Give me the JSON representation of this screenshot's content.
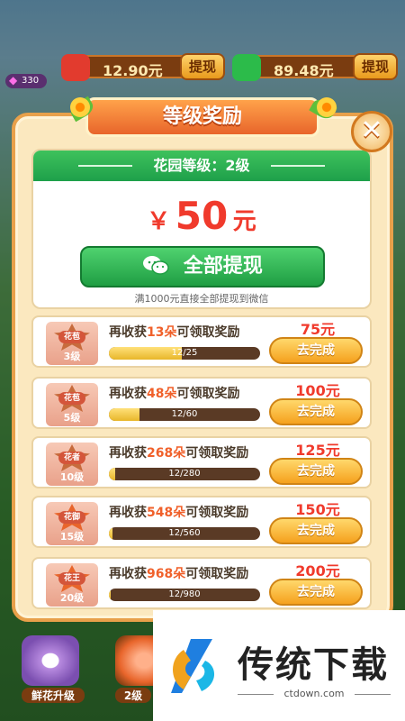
{
  "currency": {
    "red_packet": {
      "value": "12.90元",
      "button": "提现"
    },
    "wechat": {
      "value": "89.48元",
      "button": "提现"
    },
    "gem_count": "330"
  },
  "modal": {
    "title": "等级奖励",
    "close": "✕",
    "garden_level": "花园等级：2级",
    "amount_currency": "￥",
    "amount_value": "50",
    "amount_unit": "元",
    "withdraw_all": "全部提现",
    "hint": "满1000元直接全部提现到微信"
  },
  "tasks": [
    {
      "badge": "花苞",
      "level": "3级",
      "prefix": "再收获",
      "count": "13朵",
      "suffix": "可领取奖励",
      "progress_text": "12/25",
      "progress": 0.48,
      "reward": "75元",
      "button": "去完成",
      "badge_color": "#c76b3c"
    },
    {
      "badge": "花苞",
      "level": "5级",
      "prefix": "再收获",
      "count": "48朵",
      "suffix": "可领取奖励",
      "progress_text": "12/60",
      "progress": 0.2,
      "reward": "100元",
      "button": "去完成",
      "badge_color": "#c76b3c"
    },
    {
      "badge": "花者",
      "level": "10级",
      "prefix": "再收获",
      "count": "268朵",
      "suffix": "可领取奖励",
      "progress_text": "12/280",
      "progress": 0.043,
      "reward": "125元",
      "button": "去完成",
      "badge_color": "#c76b3c"
    },
    {
      "badge": "花御",
      "level": "15级",
      "prefix": "再收获",
      "count": "548朵",
      "suffix": "可领取奖励",
      "progress_text": "12/560",
      "progress": 0.021,
      "reward": "150元",
      "button": "去完成",
      "badge_color": "#e8652b"
    },
    {
      "badge": "花王",
      "level": "20级",
      "prefix": "再收获",
      "count": "968朵",
      "suffix": "可领取奖励",
      "progress_text": "12/980",
      "progress": 0.012,
      "reward": "200元",
      "button": "去完成",
      "badge_color": "#e8652b"
    }
  ],
  "bottom": {
    "upgrade_label": "鲜花升级",
    "level_label": "2级"
  },
  "watermark": {
    "title": "传统下载",
    "url": "ctdown.com"
  },
  "colors": {
    "accent_green": "#1ea04a",
    "accent_red": "#f03a2c",
    "modal_bg": "#fbe8bf"
  }
}
